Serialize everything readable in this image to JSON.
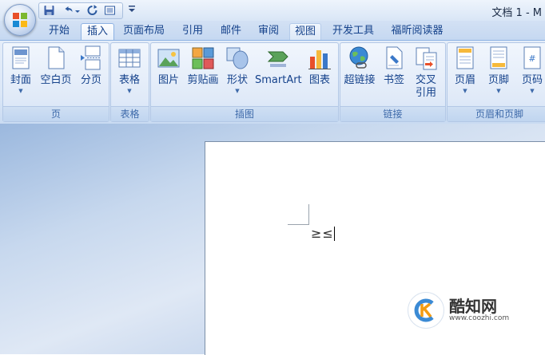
{
  "window": {
    "title": "文档 1 - M"
  },
  "quick_access": {
    "save_icon": "floppy-disk-icon",
    "undo_icon": "undo-icon",
    "redo_icon": "repeat-icon",
    "print_icon": "print-preview-icon"
  },
  "tabs": [
    {
      "label": "开始"
    },
    {
      "label": "插入",
      "active": true
    },
    {
      "label": "页面布局"
    },
    {
      "label": "引用"
    },
    {
      "label": "邮件"
    },
    {
      "label": "审阅"
    },
    {
      "label": "视图",
      "hover": true
    },
    {
      "label": "开发工具"
    },
    {
      "label": "福昕阅读器"
    }
  ],
  "ribbon": {
    "groups": {
      "pages": {
        "label": "页",
        "buttons": [
          "封面",
          "空白页",
          "分页"
        ]
      },
      "table": {
        "label": "表格",
        "buttons": [
          "表格"
        ]
      },
      "illustrations": {
        "label": "插图",
        "buttons": [
          "图片",
          "剪贴画",
          "形状",
          "SmartArt",
          "图表"
        ]
      },
      "links": {
        "label": "链接",
        "buttons": [
          "超链接",
          "书签",
          "交叉",
          "引用"
        ]
      },
      "header_footer": {
        "label": "页眉和页脚",
        "buttons": [
          "页眉",
          "页脚",
          "页码"
        ]
      }
    }
  },
  "document": {
    "text": "≥≤"
  },
  "watermark": {
    "brand": "酷知网",
    "url": "www.coozhi.com"
  },
  "colors": {
    "ribbon_text": "#15428b",
    "tab_bar": "#c5d8f1",
    "workspace": "#9bb8de"
  }
}
